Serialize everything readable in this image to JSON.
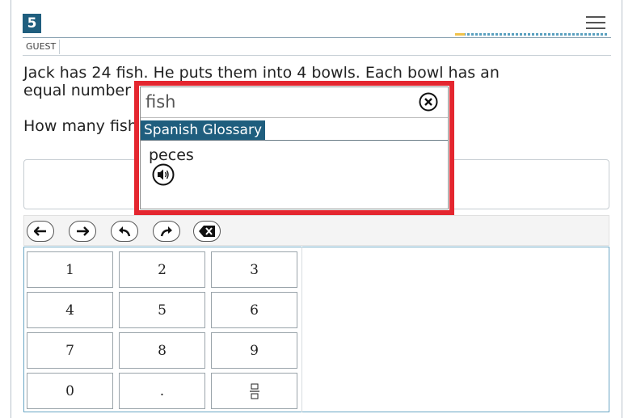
{
  "header": {
    "question_number": "5",
    "user_label": "GUEST",
    "progress_current_segments": 1
  },
  "stem": {
    "line1": "Jack has 24 fish. He puts them into 4 bowls. Each bowl has an",
    "line2": "equal number of fish.",
    "question": "How many fish are in each bowl?"
  },
  "answer": {
    "value": ""
  },
  "toolbar": {
    "buttons": [
      "left-arrow",
      "right-arrow",
      "undo",
      "redo",
      "backspace"
    ]
  },
  "keypad": {
    "keys": [
      "1",
      "2",
      "3",
      "4",
      "5",
      "6",
      "7",
      "8",
      "9",
      "0",
      ".",
      "fraction"
    ]
  },
  "glossary_popup": {
    "term": "fish",
    "tab_label": "Spanish Glossary",
    "translation": "peces",
    "highlight_color": "#e4262f"
  },
  "colors": {
    "accent": "#1f5e7e",
    "keypad_border": "#6aa6c4"
  }
}
